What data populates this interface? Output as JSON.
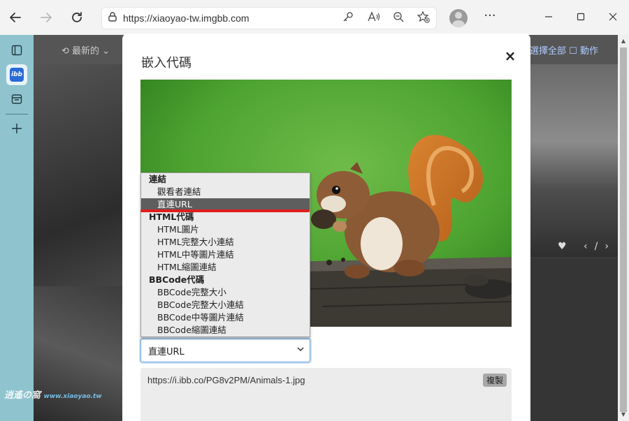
{
  "browser": {
    "url": "https://xiaoyao-tw.imgbb.com",
    "nav_icons": [
      "back-arrow-icon",
      "forward-arrow-icon",
      "refresh-icon"
    ],
    "address_icons": [
      "key-icon",
      "read-aloud-icon",
      "zoom-out-icon",
      "add-favorite-icon"
    ],
    "more_label": "···"
  },
  "background_page": {
    "sort_label": "最新的",
    "select_all_label": "選擇全部",
    "actions_label": "動作"
  },
  "modal": {
    "title": "嵌入代碼",
    "close_label": "×",
    "selected_format": "直連URL",
    "code_value": "https://i.ibb.co/PG8v2PM/Animals-1.jpg",
    "copy_label": "複製"
  },
  "dropdown": {
    "groups": [
      {
        "label": "連結",
        "options": [
          "觀看者連結",
          "直連URL"
        ]
      },
      {
        "label": "HTML代碼",
        "options": [
          "HTML圖片",
          "HTML完整大小連結",
          "HTML中等圖片連結",
          "HTML縮圖連結"
        ]
      },
      {
        "label": "BBCode代碼",
        "options": [
          "BBCode完整大小",
          "BBCode完整大小連結",
          "BBCode中等圖片連結",
          "BBCode縮圖連結"
        ]
      }
    ],
    "selected_option": "直連URL"
  },
  "watermark": {
    "line": "逍遙の窩",
    "url": "www.xiaoyao.tw"
  },
  "colors": {
    "sidebar": "#8fc4cf",
    "highlight_underline": "#e01e1e",
    "selected_option_bg": "#5e5e5e",
    "focus_border": "#6aa3d9"
  }
}
